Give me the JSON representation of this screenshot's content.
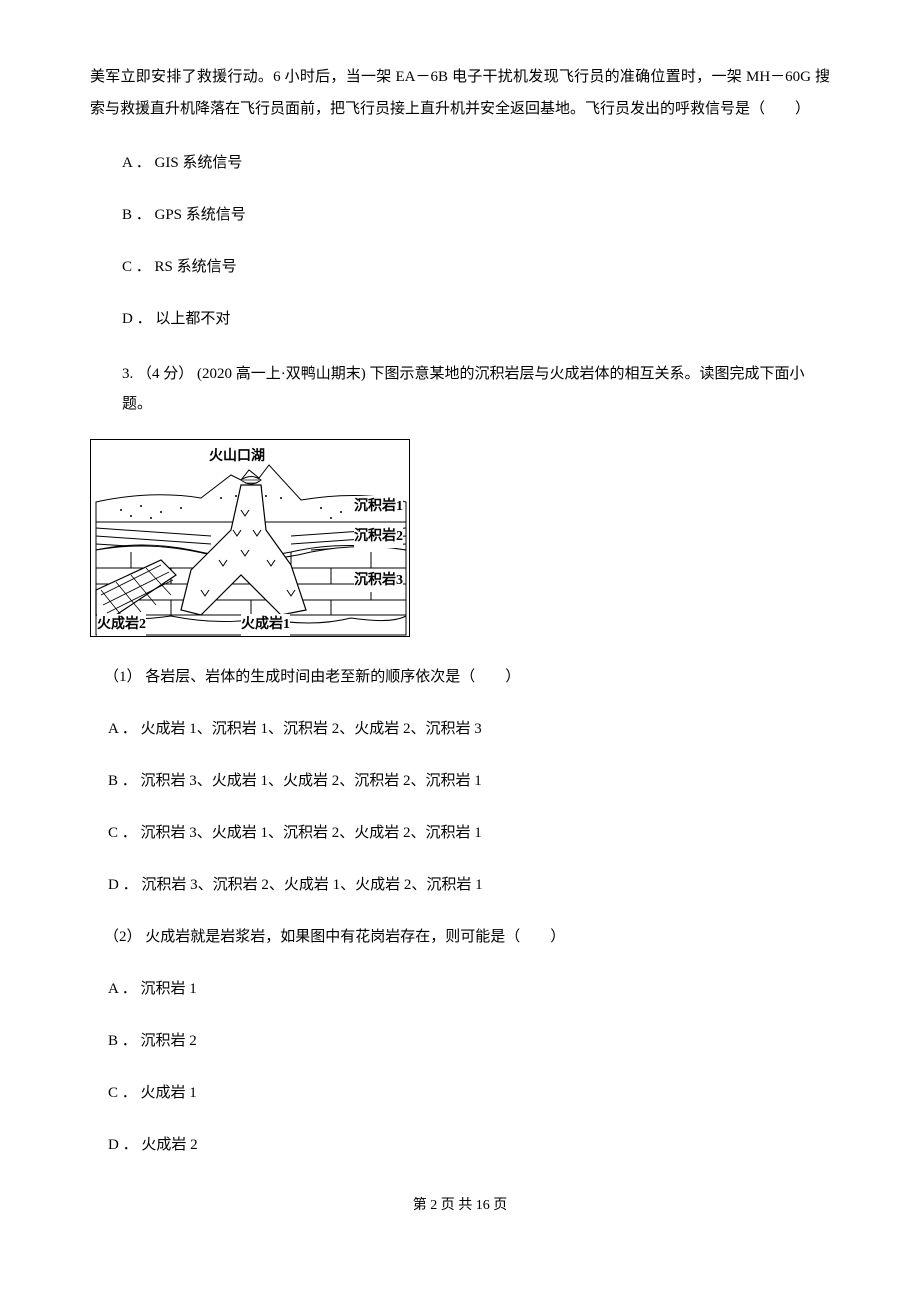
{
  "intro": "美军立即安排了救援行动。6 小时后，当一架 EA－6B 电子干扰机发现飞行员的准确位置时，一架 MH－60G 搜索与救援直升机降落在飞行员面前，把飞行员接上直升机并安全返回基地。飞行员发出的呼救信号是（　　）",
  "q2": {
    "options": {
      "A": "A ． GIS 系统信号",
      "B": "B ． GPS 系统信号",
      "C": "C ． RS 系统信号",
      "D": "D ． 以上都不对"
    }
  },
  "q3": {
    "stem": "3. （4 分） (2020 高一上·双鸭山期末) 下图示意某地的沉积岩层与火成岩体的相互关系。读图完成下面小题。",
    "figure_labels": {
      "crater_lake": "火山口湖",
      "sed1": "沉积岩1",
      "sed2": "沉积岩2",
      "sed3": "沉积岩3",
      "ign1": "火成岩1",
      "ign2": "火成岩2"
    },
    "sub1": {
      "stem": "（1） 各岩层、岩体的生成时间由老至新的顺序依次是（　　）",
      "options": {
        "A": "A ． 火成岩 1、沉积岩 1、沉积岩 2、火成岩 2、沉积岩 3",
        "B": "B ． 沉积岩 3、火成岩 1、火成岩 2、沉积岩 2、沉积岩 1",
        "C": "C ． 沉积岩 3、火成岩 1、沉积岩 2、火成岩 2、沉积岩 1",
        "D": "D ． 沉积岩 3、沉积岩 2、火成岩 1、火成岩 2、沉积岩 1"
      }
    },
    "sub2": {
      "stem": "（2） 火成岩就是岩浆岩，如果图中有花岗岩存在，则可能是（　　）",
      "options": {
        "A": "A ． 沉积岩 1",
        "B": "B ． 沉积岩 2",
        "C": "C ． 火成岩 1",
        "D": "D ． 火成岩 2"
      }
    }
  },
  "footer": "第 2 页 共 16 页"
}
